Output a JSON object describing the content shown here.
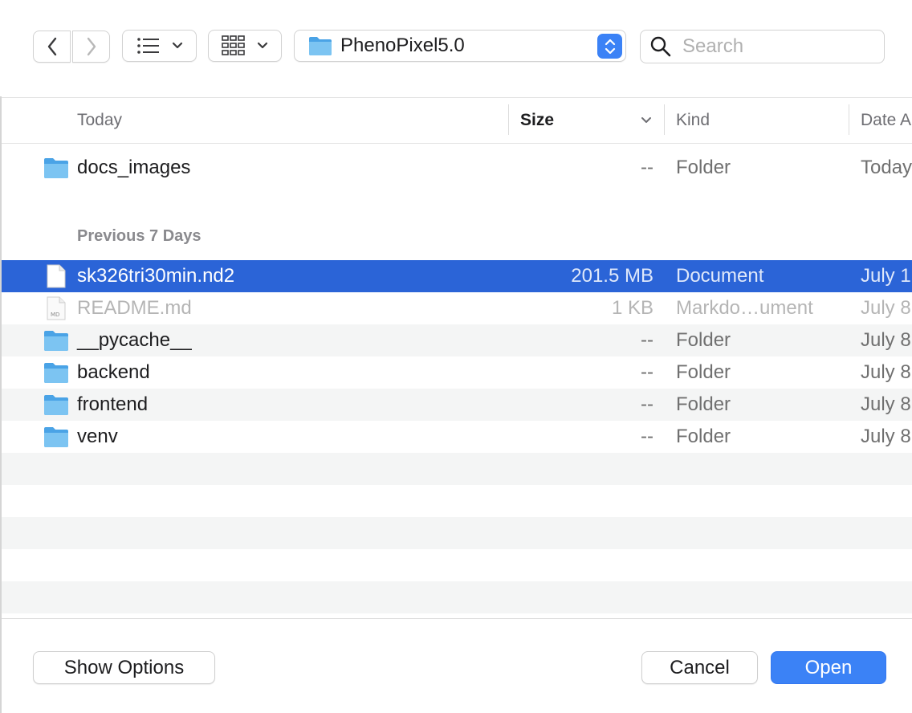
{
  "toolbar": {
    "path_label": "PhenoPixel5.0",
    "search_placeholder": "Search"
  },
  "columns": {
    "name": "Today",
    "size": "Size",
    "kind": "Kind",
    "date": "Date A"
  },
  "groups": {
    "previous": "Previous 7 Days"
  },
  "today_items": [
    {
      "name": "docs_images",
      "size": "--",
      "kind": "Folder",
      "date": "Today",
      "icon": "folder-icon"
    }
  ],
  "previous_items": [
    {
      "name": "sk326tri30min.nd2",
      "size": "201.5 MB",
      "kind": "Document",
      "date": "July 1",
      "icon": "document-icon",
      "selected": true
    },
    {
      "name": "README.md",
      "size": "1 KB",
      "kind": "Markdo…ument",
      "date": "July 8",
      "icon": "markdown-file-icon",
      "dimmed": true
    },
    {
      "name": "__pycache__",
      "size": "--",
      "kind": "Folder",
      "date": "July 8",
      "icon": "folder-icon"
    },
    {
      "name": "backend",
      "size": "--",
      "kind": "Folder",
      "date": "July 8",
      "icon": "folder-icon"
    },
    {
      "name": "frontend",
      "size": "--",
      "kind": "Folder",
      "date": "July 8",
      "icon": "folder-icon"
    },
    {
      "name": "venv",
      "size": "--",
      "kind": "Folder",
      "date": "July 8",
      "icon": "folder-icon"
    }
  ],
  "buttons": {
    "show_options": "Show Options",
    "cancel": "Cancel",
    "open": "Open"
  },
  "colors": {
    "accent": "#3b82f6",
    "selection": "#2b64d7",
    "folder": "#5fb2ec"
  }
}
